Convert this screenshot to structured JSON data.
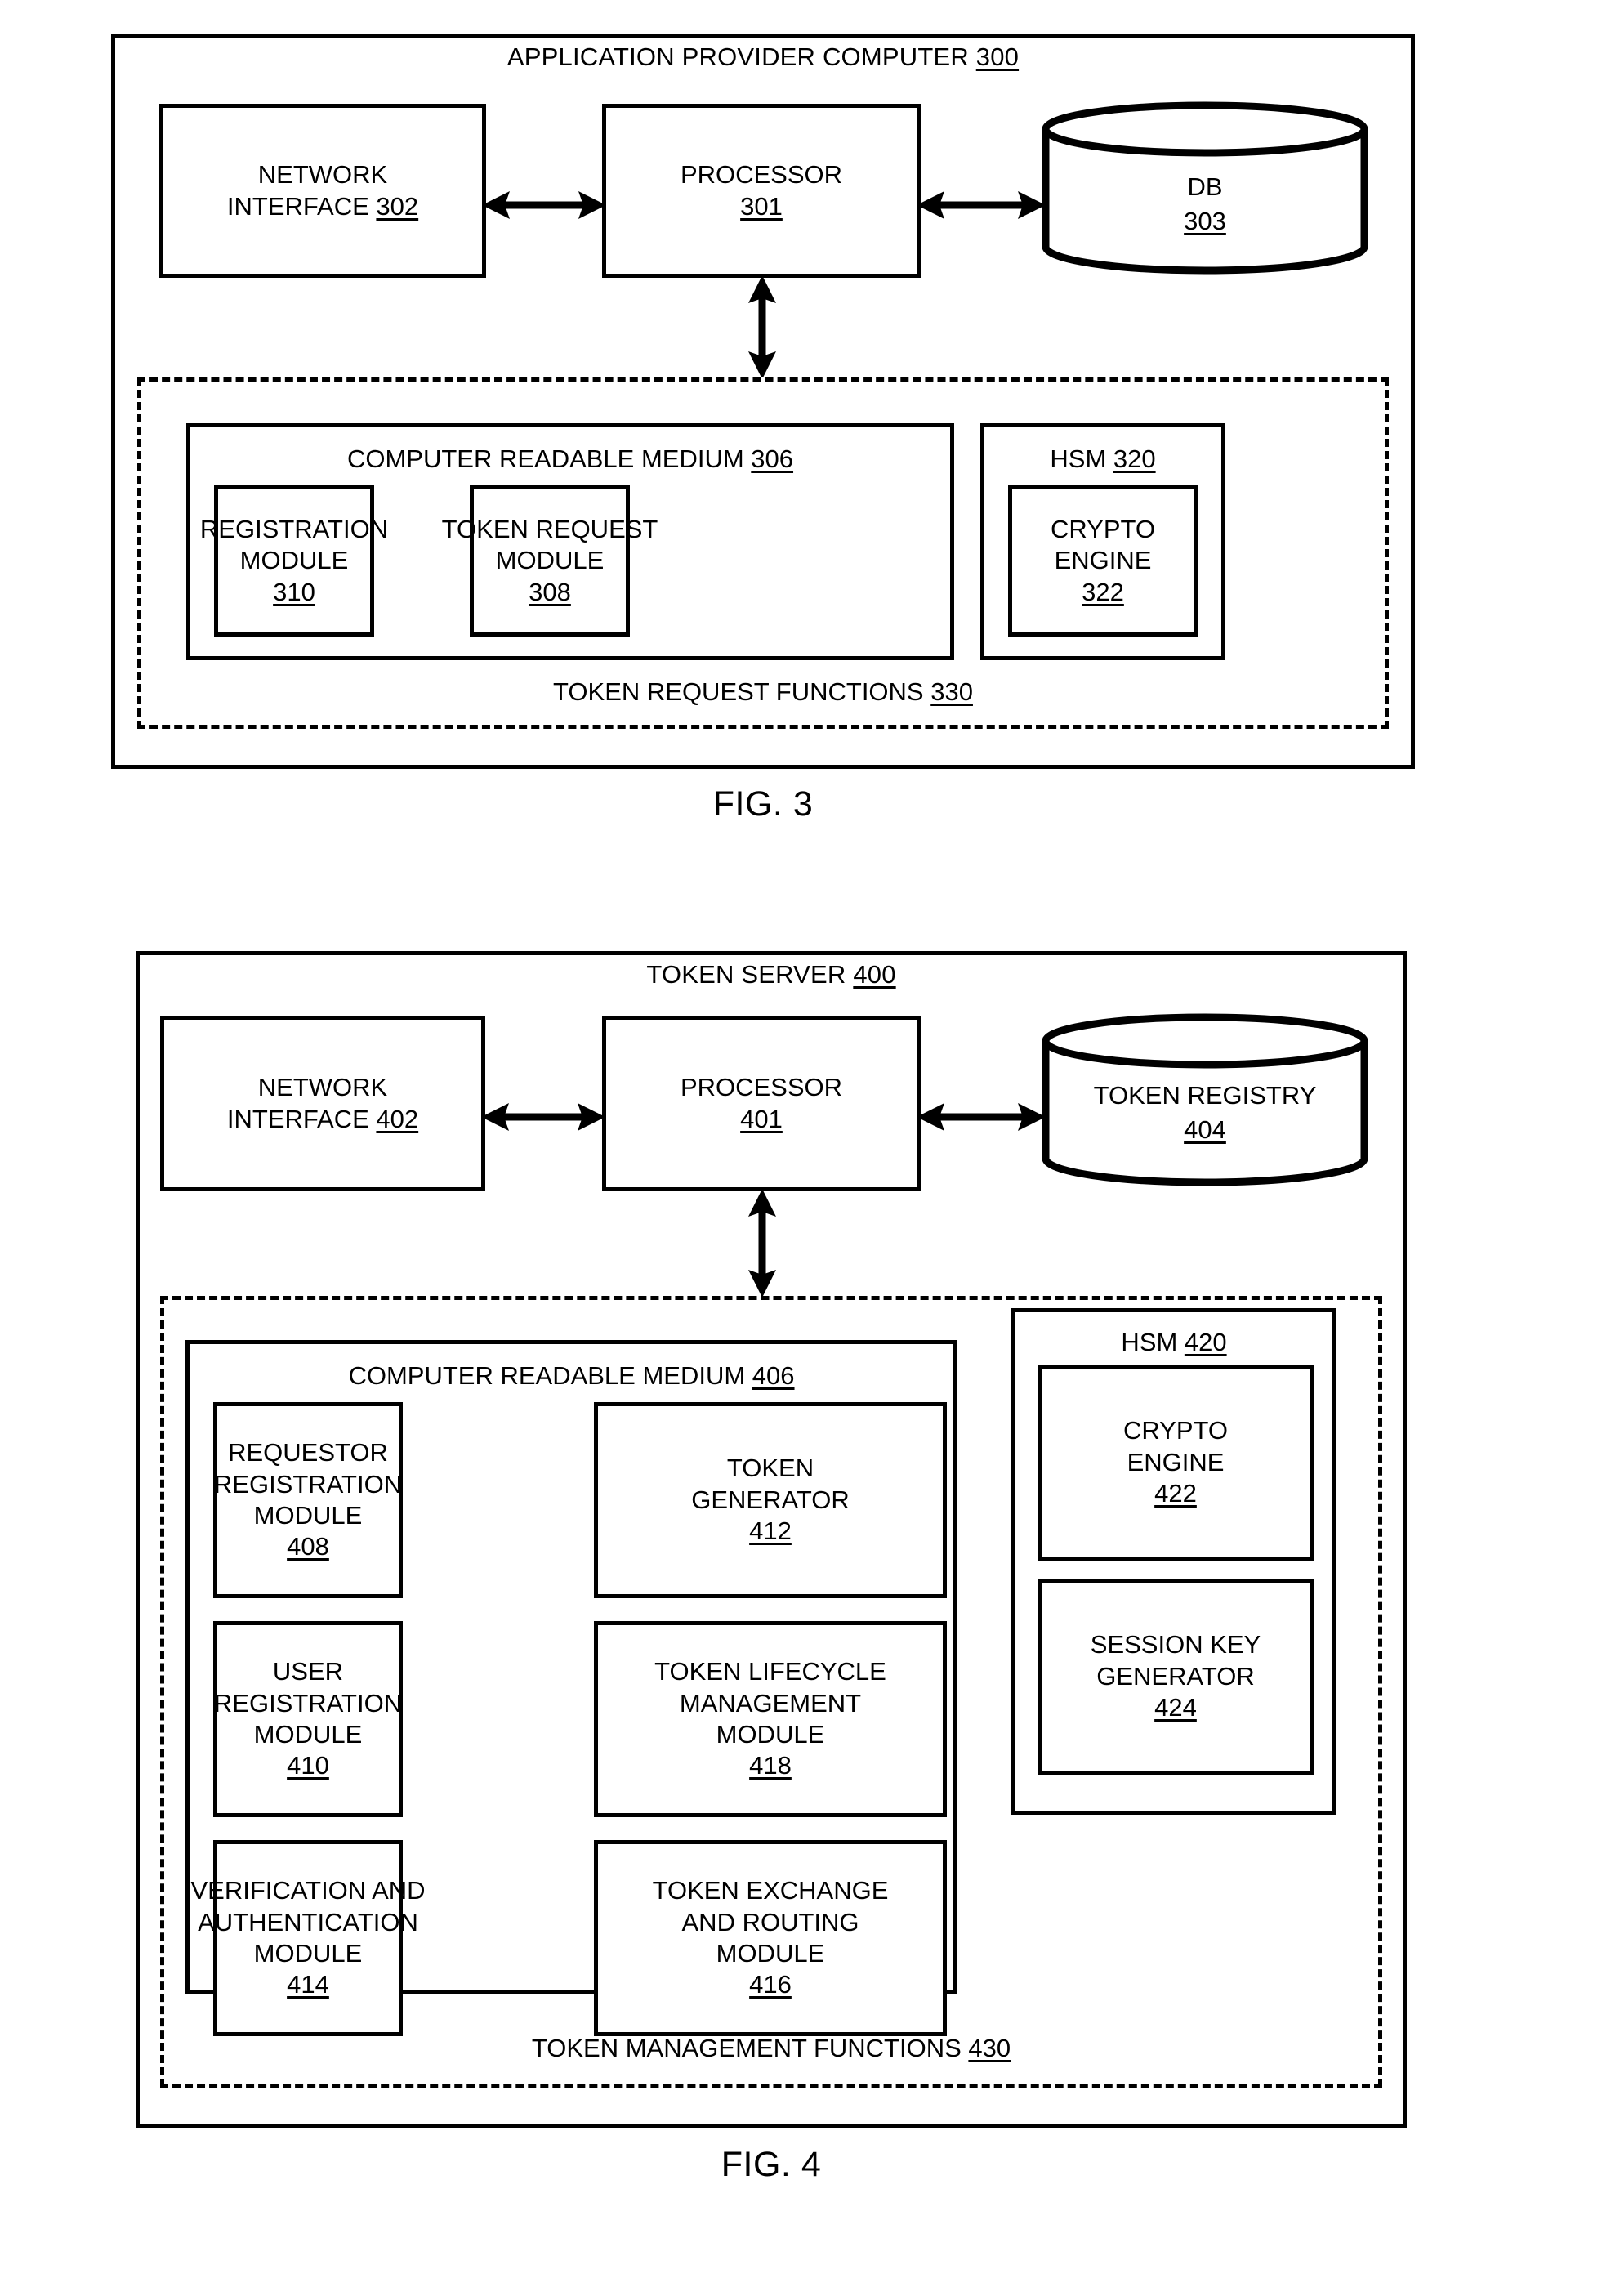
{
  "figures": [
    {
      "caption": "FIG. 3",
      "title_text": "APPLICATION PROVIDER COMPUTER ",
      "title_ref": "300",
      "network_interface": {
        "line1": "NETWORK",
        "line2": "INTERFACE ",
        "ref": "302"
      },
      "processor": {
        "line1": "PROCESSOR",
        "ref": "301"
      },
      "database": {
        "line1": "DB",
        "ref": "303"
      },
      "dashed_footer_text": "TOKEN REQUEST FUNCTIONS ",
      "dashed_footer_ref": "330",
      "crm": {
        "heading_text": "COMPUTER READABLE MEDIUM ",
        "heading_ref": "306",
        "modules": [
          {
            "lines": [
              "REGISTRATION",
              "MODULE"
            ],
            "ref": "310"
          },
          {
            "lines": [
              "TOKEN REQUEST",
              "MODULE"
            ],
            "ref": "308"
          }
        ]
      },
      "hsm": {
        "heading_text": "HSM ",
        "heading_ref": "320",
        "modules": [
          {
            "lines": [
              "CRYPTO",
              "ENGINE"
            ],
            "ref": "322"
          }
        ]
      }
    },
    {
      "caption": "FIG. 4",
      "title_text": "TOKEN SERVER ",
      "title_ref": "400",
      "network_interface": {
        "line1": "NETWORK",
        "line2": "INTERFACE ",
        "ref": "402"
      },
      "processor": {
        "line1": "PROCESSOR",
        "ref": "401"
      },
      "database": {
        "line1": "TOKEN REGISTRY",
        "ref": "404"
      },
      "dashed_footer_text": "TOKEN MANAGEMENT FUNCTIONS ",
      "dashed_footer_ref": "430",
      "crm": {
        "heading_text": "COMPUTER READABLE MEDIUM ",
        "heading_ref": "406",
        "modules": [
          {
            "lines": [
              "REQUESTOR",
              "REGISTRATION",
              "MODULE"
            ],
            "ref": "408"
          },
          {
            "lines": [
              "TOKEN",
              "GENERATOR"
            ],
            "ref": "412"
          },
          {
            "lines": [
              "USER",
              "REGISTRATION",
              "MODULE"
            ],
            "ref": "410"
          },
          {
            "lines": [
              "TOKEN LIFECYCLE",
              "MANAGEMENT",
              "MODULE"
            ],
            "ref": "418"
          },
          {
            "lines": [
              "VERIFICATION AND",
              "AUTHENTICATION",
              "MODULE"
            ],
            "ref": "414"
          },
          {
            "lines": [
              "TOKEN EXCHANGE",
              "AND ROUTING",
              "MODULE"
            ],
            "ref": "416"
          }
        ]
      },
      "hsm": {
        "heading_text": "HSM ",
        "heading_ref": "420",
        "modules": [
          {
            "lines": [
              "CRYPTO",
              "ENGINE"
            ],
            "ref": "422"
          },
          {
            "lines": [
              "SESSION KEY",
              "GENERATOR"
            ],
            "ref": "424"
          }
        ]
      }
    }
  ],
  "colors": {
    "ink": "#000000",
    "paper": "#ffffff"
  }
}
